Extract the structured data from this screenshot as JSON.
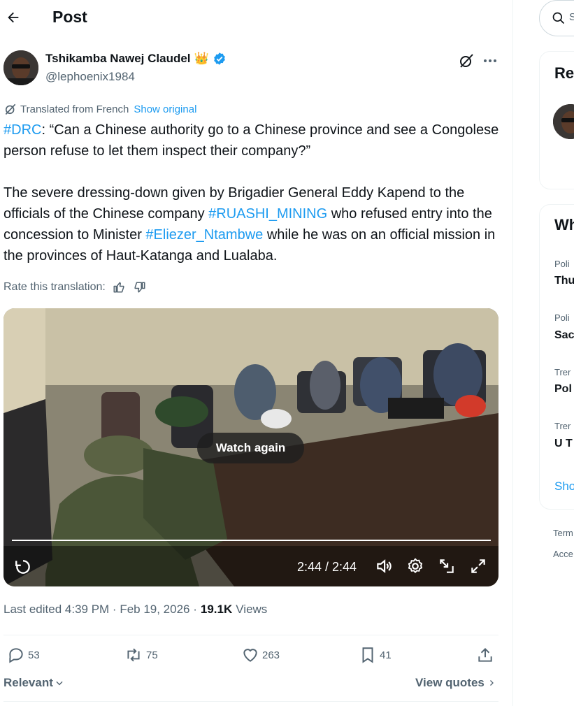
{
  "header": {
    "title": "Post"
  },
  "author": {
    "name": "Tshikamba Nawej Claudel",
    "badge_emoji": "👑",
    "handle": "@lephoenix1984"
  },
  "translation": {
    "label": "Translated from French",
    "show_original": "Show original",
    "rate_label": "Rate this translation:"
  },
  "tweet": {
    "p1_hashtag": "#DRC",
    "p1_text": ": “Can a Chinese authority go to a Chinese province and see a Congolese person refuse to let them inspect their company?”",
    "p2_a": "The severe dressing-down given by Brigadier General Eddy Kapend to the officials of the Chinese company ",
    "p2_tag1": "#RUASHI_MINING",
    "p2_b": " who refused entry into the concession to Minister ",
    "p2_tag2": "#Eliezer_Ntambwe",
    "p2_c": " while he was on an official mission in the provinces of Haut-Katanga and Lualaba."
  },
  "video": {
    "watch_again": "Watch again",
    "time": "2:44 / 2:44",
    "progress": 1.0
  },
  "meta": {
    "edited": "Last edited 4:39 PM · Feb 19, 2026 ·",
    "views_count": "19.1K",
    "views_label": "Views"
  },
  "actions": {
    "replies": "53",
    "reposts": "75",
    "likes": "263",
    "bookmarks": "41"
  },
  "replies_sort": {
    "relevant": "Relevant",
    "view_quotes": "View quotes"
  },
  "sidebar": {
    "search_placeholder": "S",
    "card1_title": "Re",
    "card2_title": "Wh",
    "trends": [
      {
        "category": "Poli",
        "name": "Thu"
      },
      {
        "category": "Poli",
        "name": "Sac"
      },
      {
        "category": "Trer",
        "name": "Pol"
      },
      {
        "category": "Trer",
        "name": "U T"
      }
    ],
    "show_more": "Sho",
    "footer_terms": "Term",
    "footer_access": "Acce"
  },
  "colors": {
    "accent": "#1d9bf0",
    "text": "#0f1419",
    "muted": "#536471"
  }
}
